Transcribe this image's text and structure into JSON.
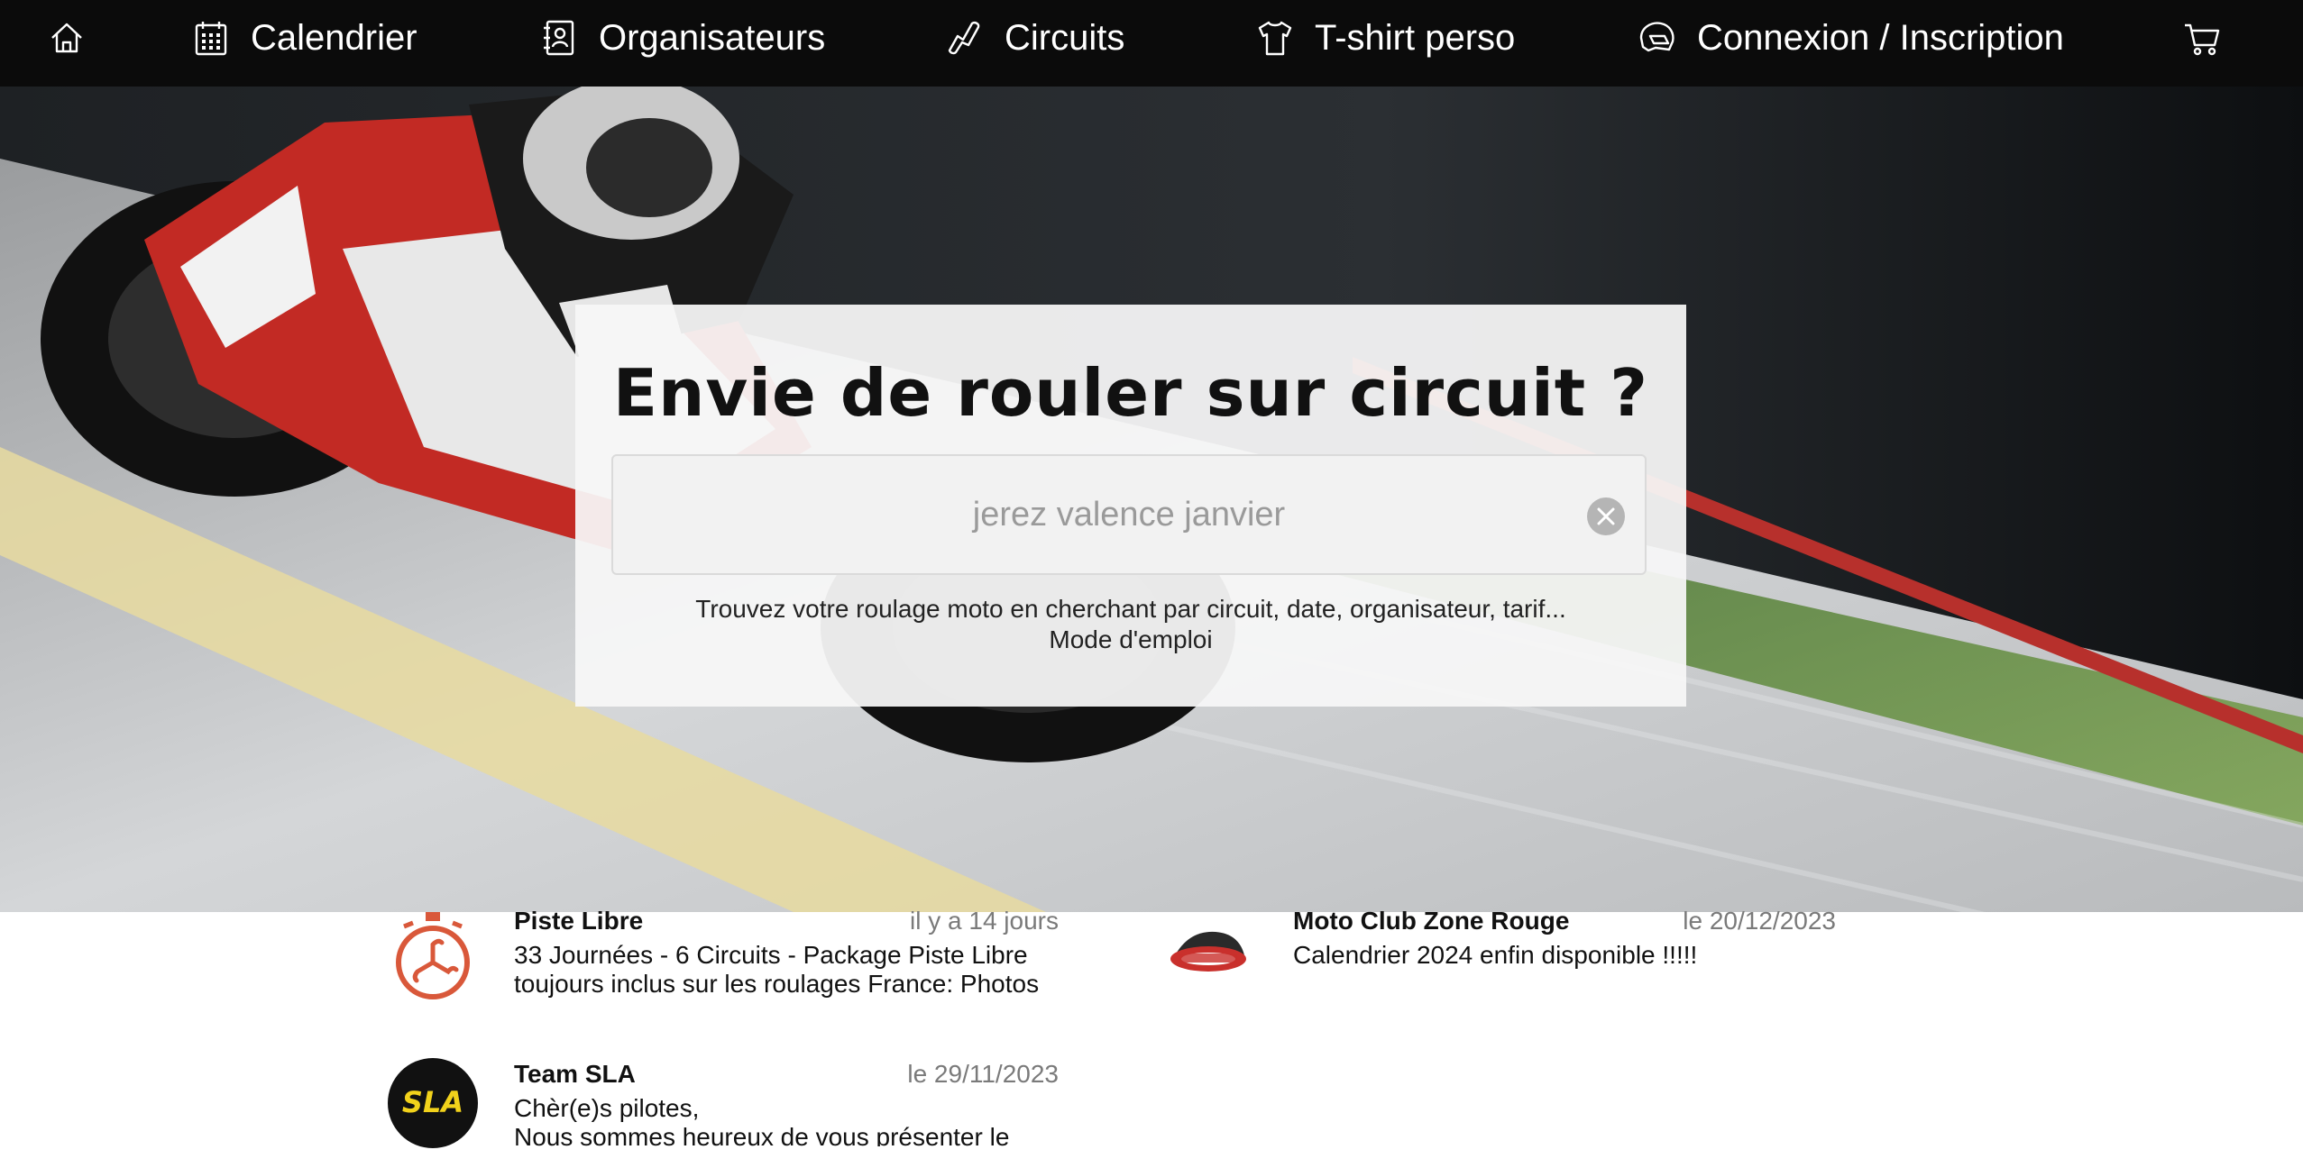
{
  "nav": {
    "home_icon": "home-icon",
    "items": [
      {
        "label": "Calendrier",
        "icon": "calendar-icon"
      },
      {
        "label": "Organisateurs",
        "icon": "contact-book-icon"
      },
      {
        "label": "Circuits",
        "icon": "track-icon"
      },
      {
        "label": "T-shirt perso",
        "icon": "tshirt-icon"
      },
      {
        "label": "Connexion / Inscription",
        "icon": "helmet-icon"
      }
    ],
    "cart_icon": "cart-icon"
  },
  "search": {
    "title": "Envie de rouler sur circuit ?",
    "placeholder": "jerez valence janvier",
    "value": "",
    "subtitle": "Trouvez votre roulage moto en cherchant par circuit, date, organisateur, tarif...",
    "help_link": "Mode d'emploi"
  },
  "news": [
    {
      "author": "Piste Libre",
      "date": "il y a 14 jours",
      "text": "33 Journées - 6 Circuits - Package Piste Libre toujours inclus sur les roulages France: Photos",
      "logo": "stopwatch-logo"
    },
    {
      "author": "Moto Club Zone Rouge",
      "date": "le 20/12/2023",
      "text": "Calendrier 2024 enfin disponible !!!!!",
      "logo": "moto-club-zone-rouge-logo"
    },
    {
      "author": "Team SLA",
      "date": "le 29/11/2023",
      "text": "Chèr(e)s pilotes, Nous sommes heureux de vous présenter le",
      "text_line1": "Chèr(e)s pilotes,",
      "text_line2": "Nous sommes heureux de vous présenter le",
      "logo": "sla-logo",
      "logo_text": "SLA"
    }
  ],
  "colors": {
    "nav_bg": "#0b0b0b",
    "accent_red": "#c9302c",
    "piste_libre_orange": "#d9583a",
    "sla_yellow": "#f2d21b"
  }
}
